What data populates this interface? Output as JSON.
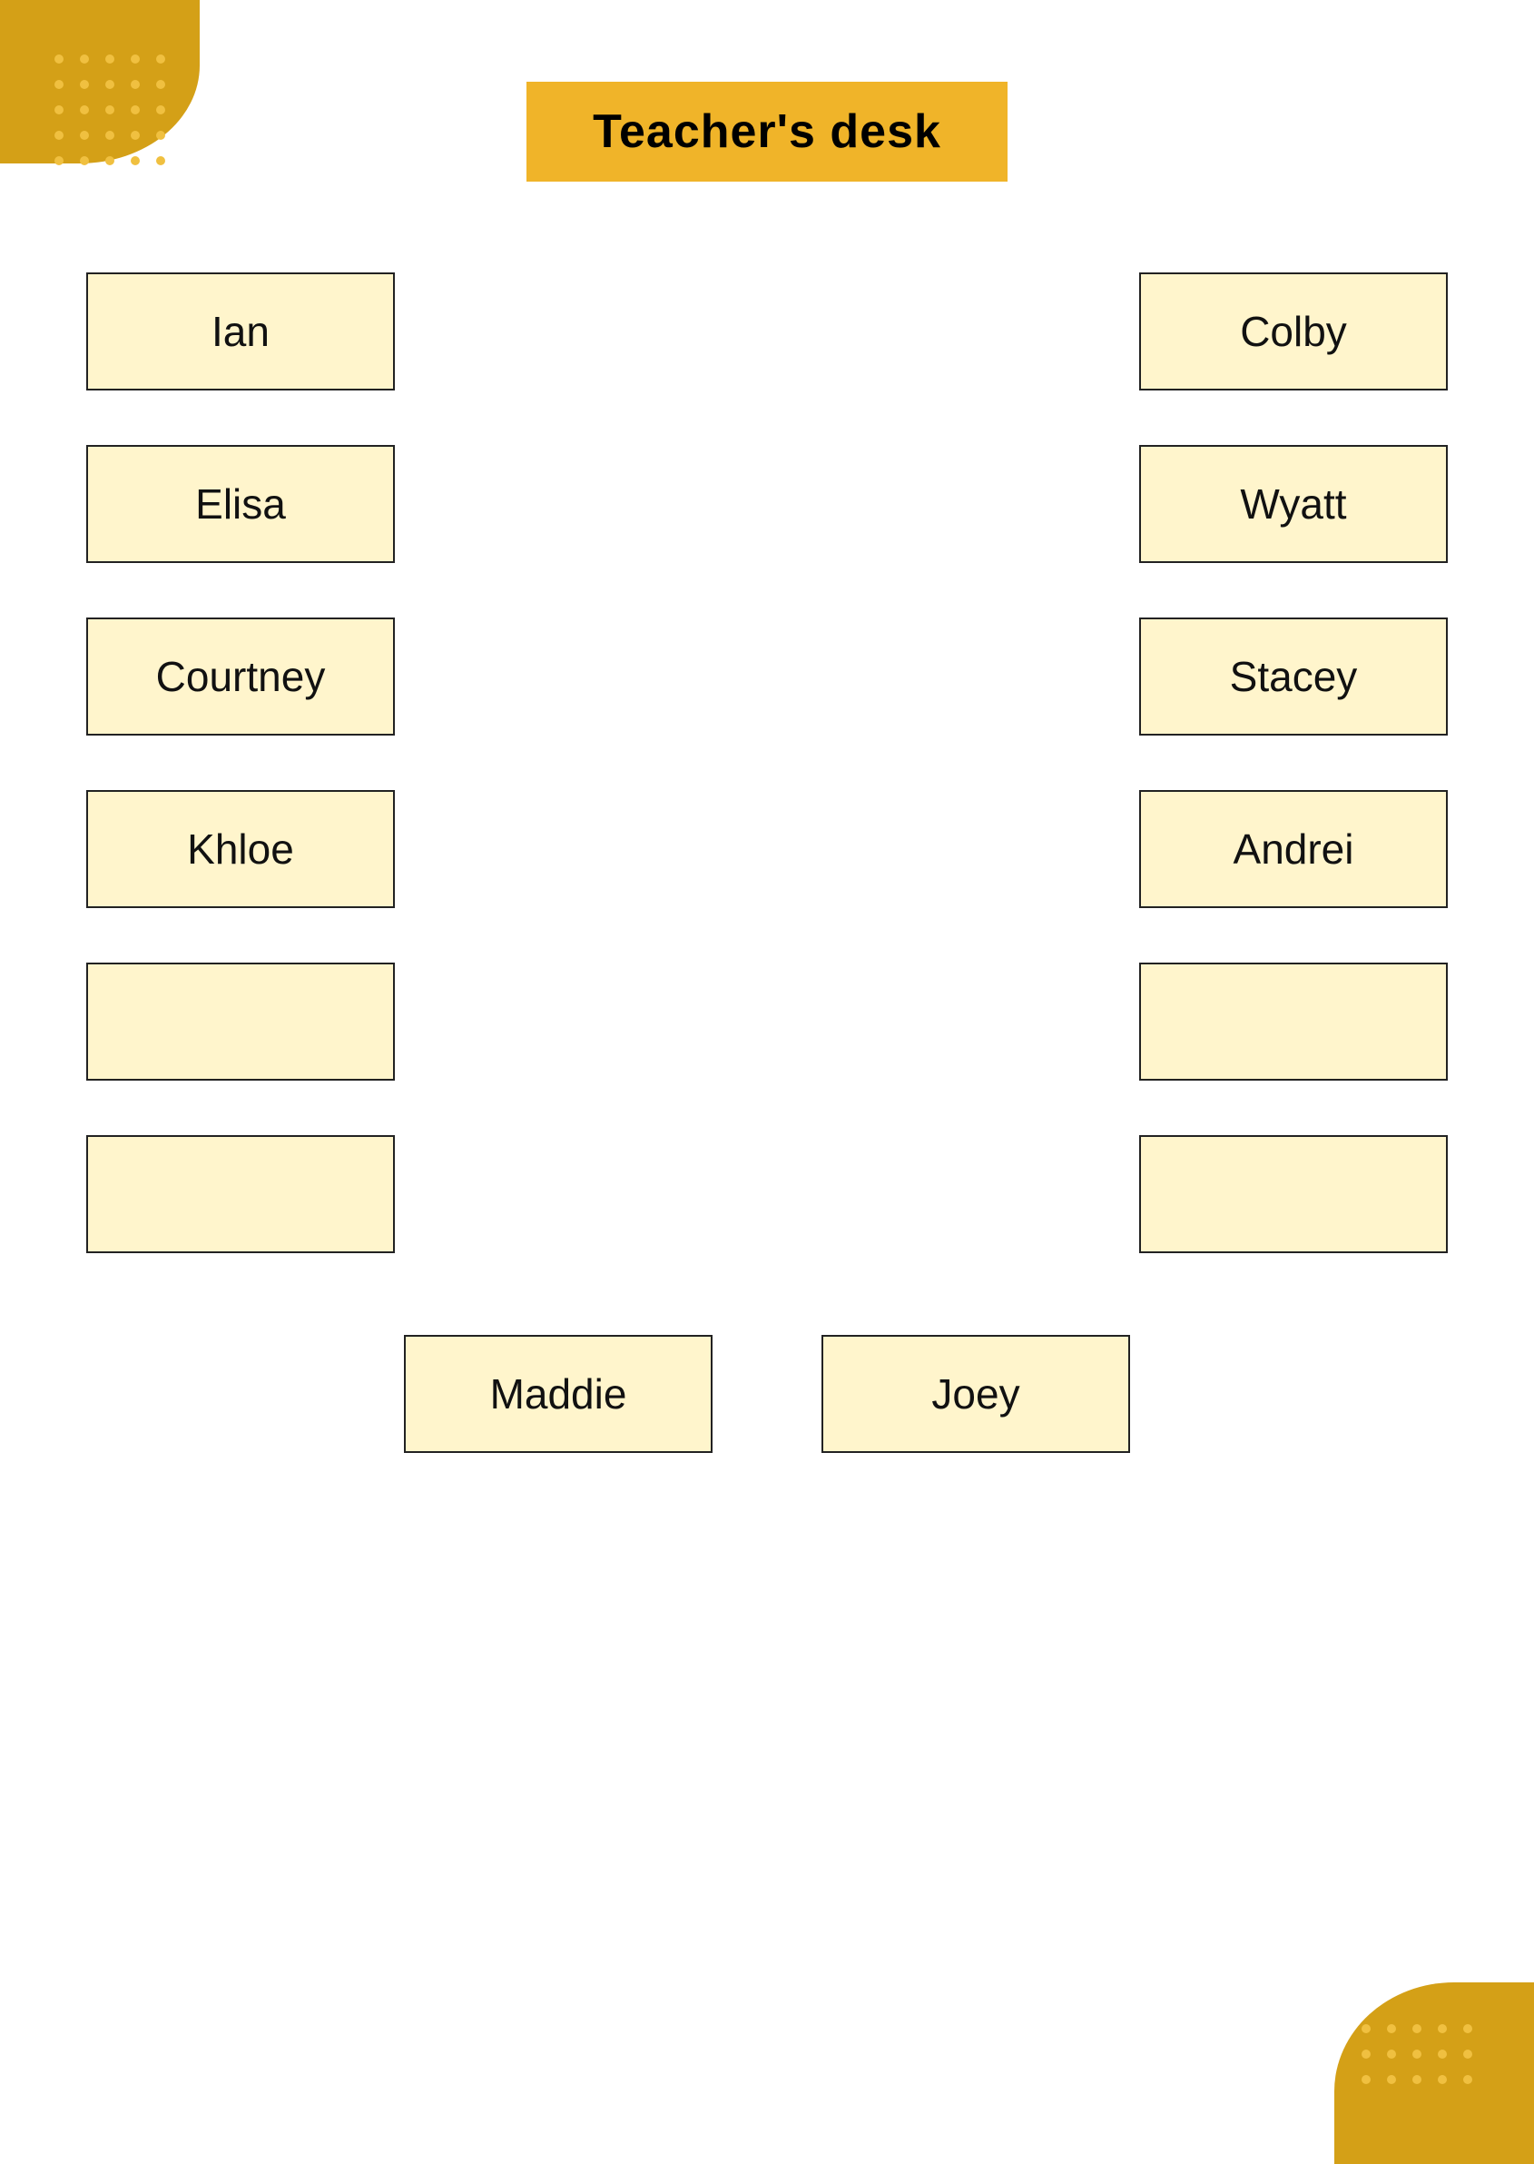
{
  "page": {
    "title": "Teacher's desk",
    "background_color": "#ffffff"
  },
  "decorations": {
    "top_left_blob_color": "#D4A017",
    "bottom_right_blob_color": "#D4A017",
    "dot_color": "#F0C040"
  },
  "header": {
    "label": "Teacher's desk",
    "bg_color": "#F0B429",
    "border_color": "#F0B429"
  },
  "seats": {
    "left_column": [
      {
        "id": "ian",
        "name": "Ian"
      },
      {
        "id": "elisa",
        "name": "Elisa"
      },
      {
        "id": "courtney",
        "name": "Courtney"
      },
      {
        "id": "khloe",
        "name": "Khloe"
      },
      {
        "id": "empty-left-1",
        "name": ""
      },
      {
        "id": "empty-left-2",
        "name": ""
      }
    ],
    "right_column": [
      {
        "id": "colby",
        "name": "Colby"
      },
      {
        "id": "wyatt",
        "name": "Wyatt"
      },
      {
        "id": "stacey",
        "name": "Stacey"
      },
      {
        "id": "andrei",
        "name": "Andrei"
      },
      {
        "id": "empty-right-1",
        "name": ""
      },
      {
        "id": "empty-right-2",
        "name": ""
      }
    ],
    "bottom_row": [
      {
        "id": "maddie",
        "name": "Maddie"
      },
      {
        "id": "joey",
        "name": "Joey"
      }
    ]
  }
}
